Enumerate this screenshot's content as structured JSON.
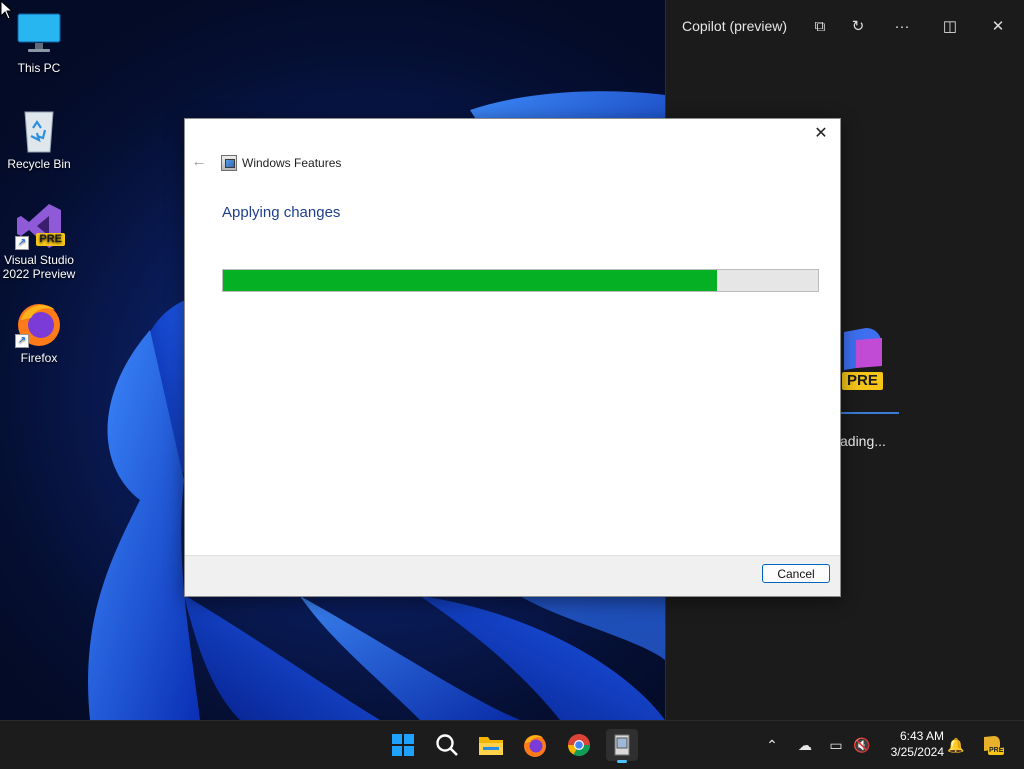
{
  "desktop": {
    "icons": [
      {
        "label": "This PC"
      },
      {
        "label": "Recycle Bin"
      },
      {
        "label": "Visual Studio 2022 Preview",
        "badge": "PRE"
      },
      {
        "label": "Firefox"
      }
    ]
  },
  "copilot": {
    "title": "Copilot (preview)",
    "badge": "PRE",
    "loading_text": "ading..."
  },
  "dialog": {
    "title": "Windows Features",
    "heading": "Applying changes",
    "progress_percent": 83,
    "cancel_label": "Cancel"
  },
  "taskbar": {
    "apps": [
      "start-icon",
      "search-icon",
      "file-explorer-icon",
      "firefox-icon",
      "chrome-icon",
      "windows-features-icon"
    ],
    "time": "6:43 AM",
    "date": "3/25/2024",
    "copilot_badge": "PRE"
  },
  "colors": {
    "progress_fill": "#06b025",
    "heading": "#1e3f8c",
    "accent": "#0067c0"
  }
}
